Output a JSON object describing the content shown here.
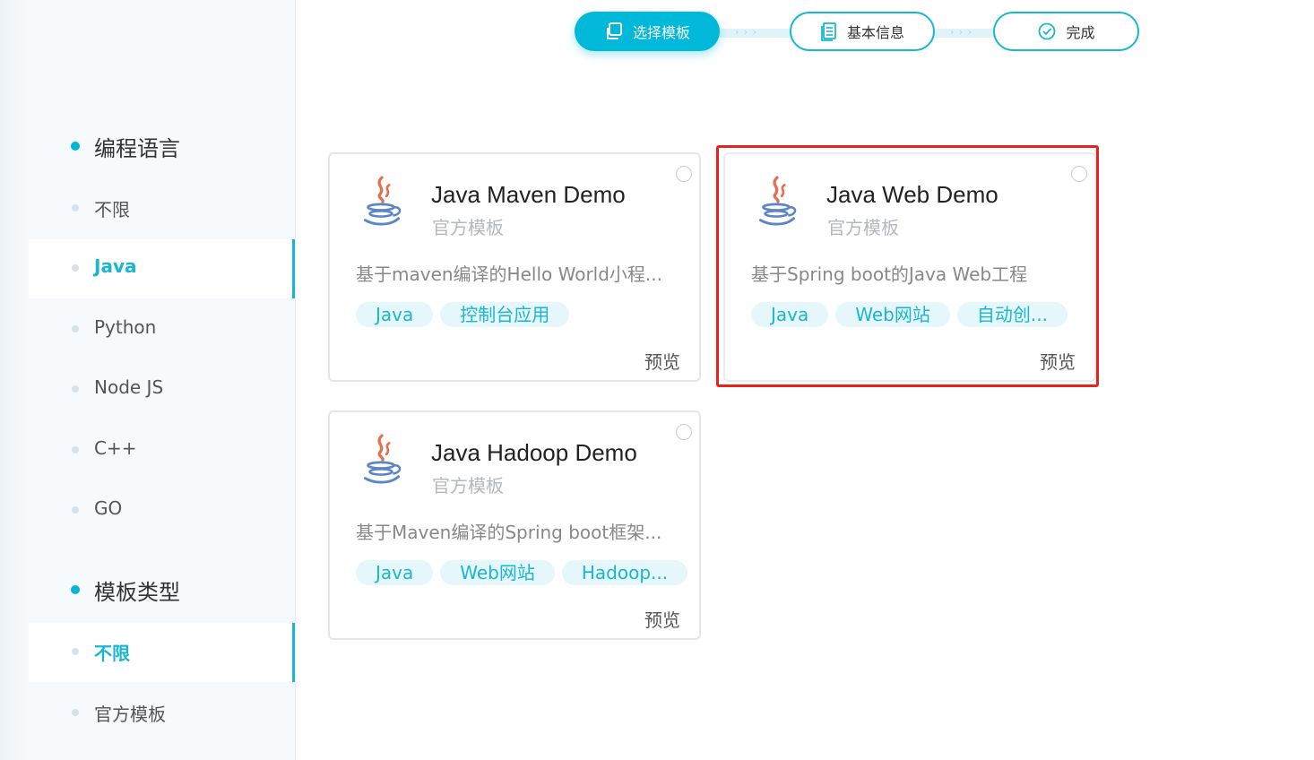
{
  "stepper": {
    "steps": [
      {
        "label": "选择模板",
        "icon": "template-copy-icon",
        "active": true
      },
      {
        "label": "基本信息",
        "icon": "document-list-icon",
        "active": false
      },
      {
        "label": "完成",
        "icon": "check-circle-icon",
        "active": false
      }
    ],
    "separator": "› › ›"
  },
  "sidebar": {
    "groups": [
      {
        "title": "编程语言",
        "items": [
          {
            "label": "不限",
            "active": false
          },
          {
            "label": "Java",
            "active": true
          },
          {
            "label": "Python",
            "active": false
          },
          {
            "label": "Node JS",
            "active": false
          },
          {
            "label": "C++",
            "active": false
          },
          {
            "label": "GO",
            "active": false
          }
        ]
      },
      {
        "title": "模板类型",
        "items": [
          {
            "label": "不限",
            "active": true
          },
          {
            "label": "官方模板",
            "active": false
          }
        ]
      }
    ]
  },
  "cards": [
    {
      "title": "Java Maven Demo",
      "subtitle": "官方模板",
      "description": "基于maven编译的Hello World小程...",
      "tags": [
        "Java",
        "控制台应用"
      ],
      "preview": "预览",
      "icon": "java-logo-icon",
      "selected": false
    },
    {
      "title": "Java Web Demo",
      "subtitle": "官方模板",
      "description": "基于Spring boot的Java Web工程",
      "tags": [
        "Java",
        "Web网站",
        "自动创..."
      ],
      "preview": "预览",
      "icon": "java-logo-icon",
      "selected": false,
      "highlighted": true
    },
    {
      "title": "Java Hadoop Demo",
      "subtitle": "官方模板",
      "description": "基于Maven编译的Spring boot框架...",
      "tags": [
        "Java",
        "Web网站",
        "Hadoop..."
      ],
      "preview": "预览",
      "icon": "java-logo-icon",
      "selected": false
    }
  ],
  "colors": {
    "accent": "#00b9da",
    "highlight_frame": "#e8221d",
    "tag_bg": "#e6f7fb",
    "sidebar_bg": "#f6fafd"
  }
}
